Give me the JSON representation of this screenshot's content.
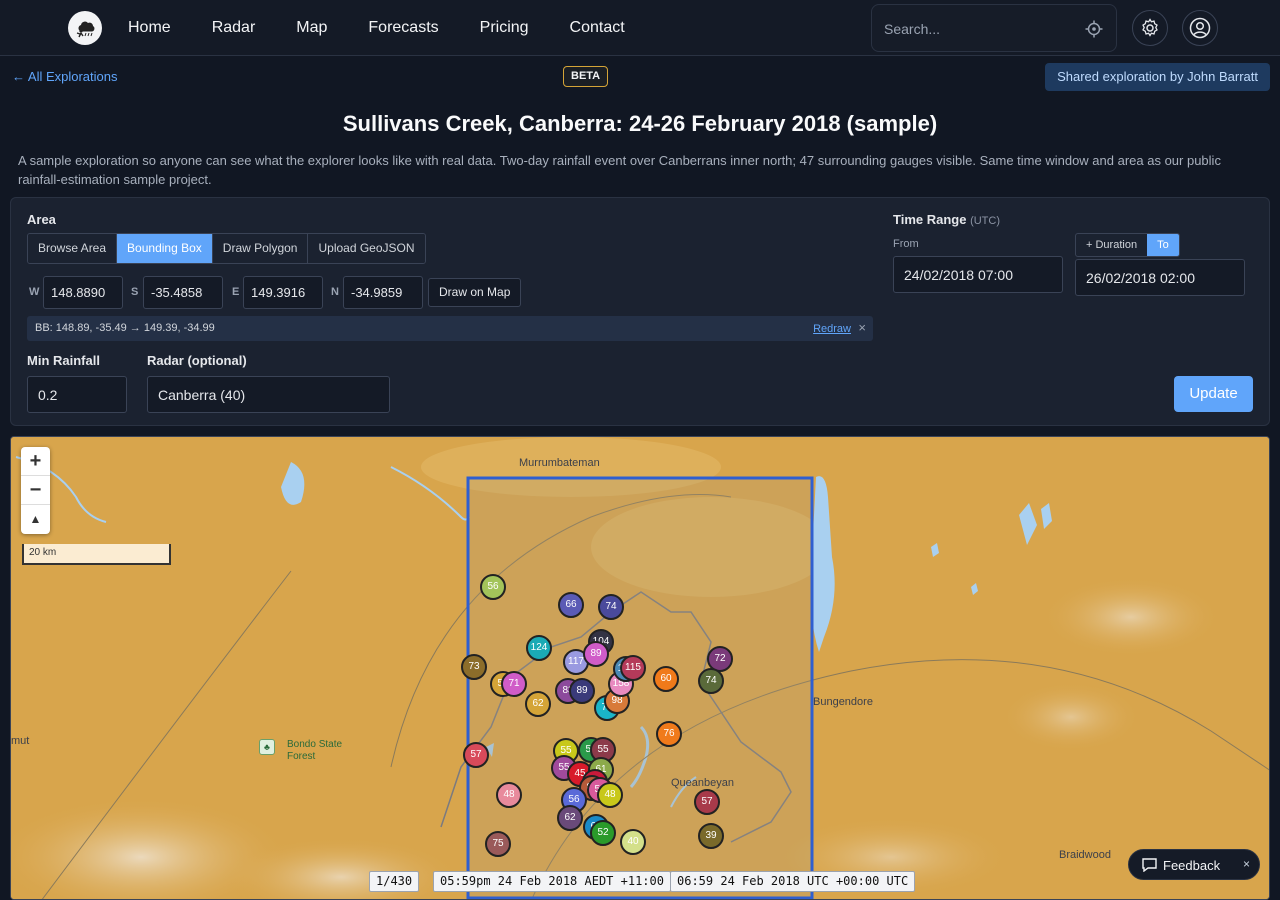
{
  "nav": {
    "links": [
      "Home",
      "Radar",
      "Map",
      "Forecasts",
      "Pricing",
      "Contact"
    ],
    "search_placeholder": "Search..."
  },
  "header": {
    "back_label": "← All Explorations",
    "beta_label": "BETA",
    "shared_label": "Shared exploration by John Barratt",
    "title": "Sullivans Creek, Canberra: 24-26 February 2018 (sample)",
    "description": "A sample exploration so anyone can see what the explorer looks like with real data. Two-day rainfall event over Canberrans inner north; 47 surrounding gauges visible. Same time window and area as our public rainfall-estimation sample project."
  },
  "area": {
    "label": "Area",
    "modes": [
      "Browse Area",
      "Bounding Box",
      "Draw Polygon",
      "Upload GeoJSON"
    ],
    "active_mode": "Bounding Box",
    "w_label": "W",
    "w_value": "148.8890",
    "s_label": "S",
    "s_value": "-35.4858",
    "e_label": "E",
    "e_value": "149.3916",
    "n_label": "N",
    "n_value": "-34.9859",
    "draw_button": "Draw on Map",
    "bb_summary": "BB: 148.89, -35.49 → 149.39, -34.99",
    "redraw_label": "Redraw",
    "clear_icon": "×"
  },
  "min_rainfall": {
    "label": "Min Rainfall",
    "value": "0.2"
  },
  "radar": {
    "label": "Radar (optional)",
    "value": "Canberra (40)"
  },
  "time_range": {
    "label": "Time Range",
    "unit": "(UTC)",
    "from_label": "From",
    "from_value": "24/02/2018 07:00",
    "duration_label": "+ Duration",
    "to_label": "To",
    "to_value": "26/02/2018 02:00"
  },
  "update_button": "Update",
  "map": {
    "places": [
      "Murrumbateman",
      "Bungendore",
      "Queanbeyan",
      "Bondo State Forest",
      "mut",
      "Braidwood"
    ],
    "scale_label": "20 km",
    "zoom_in": "+",
    "zoom_out": "−",
    "compass": "▲",
    "gauges": [
      {
        "v": "56",
        "c": "#a3c45a"
      },
      {
        "v": "66",
        "c": "#5b5bb5"
      },
      {
        "v": "74",
        "c": "#4a4a9c"
      },
      {
        "v": "104",
        "c": "#333344"
      },
      {
        "v": "124",
        "c": "#1aaab5"
      },
      {
        "v": "117",
        "c": "#9a9ae0"
      },
      {
        "v": "89",
        "c": "#d05cc8"
      },
      {
        "v": "73",
        "c": "#8c6d2a"
      },
      {
        "v": "58",
        "c": "#d4a437"
      },
      {
        "v": "71",
        "c": "#d05cc8"
      },
      {
        "v": "83",
        "c": "#8c4a9c"
      },
      {
        "v": "89",
        "c": "#3a3a7a"
      },
      {
        "v": "62",
        "c": "#d4a437"
      },
      {
        "v": "72",
        "c": "#1ab5c8"
      },
      {
        "v": "98",
        "c": "#d87a3a"
      },
      {
        "v": "158",
        "c": "#e88ac0"
      },
      {
        "v": "100",
        "c": "#4a8ab5"
      },
      {
        "v": "115",
        "c": "#b53a5a"
      },
      {
        "v": "60",
        "c": "#f07a1a"
      },
      {
        "v": "72",
        "c": "#7a3a7a"
      },
      {
        "v": "74",
        "c": "#5a6a3a"
      },
      {
        "v": "76",
        "c": "#f07a1a"
      },
      {
        "v": "57",
        "c": "#d84a5a"
      },
      {
        "v": "55",
        "c": "#c8c81a"
      },
      {
        "v": "54",
        "c": "#2a9a4a"
      },
      {
        "v": "55",
        "c": "#8c3a4a"
      },
      {
        "v": "55",
        "c": "#a04a9c"
      },
      {
        "v": "45",
        "c": "#d81a2a"
      },
      {
        "v": "61",
        "c": "#8caa4a"
      },
      {
        "v": "87",
        "c": "#c81a3a"
      },
      {
        "v": "84",
        "c": "#b55a3a"
      },
      {
        "v": "53",
        "c": "#d85a9c"
      },
      {
        "v": "48",
        "c": "#c8c81a"
      },
      {
        "v": "48",
        "c": "#e88a9c"
      },
      {
        "v": "56",
        "c": "#5a6ad8"
      },
      {
        "v": "62",
        "c": "#6a4a7a"
      },
      {
        "v": "64",
        "c": "#1a8ac8"
      },
      {
        "v": "52",
        "c": "#2a9a2a"
      },
      {
        "v": "40",
        "c": "#d4e08a"
      },
      {
        "v": "57",
        "c": "#a83a4a"
      },
      {
        "v": "39",
        "c": "#7a6a2a"
      },
      {
        "v": "75",
        "c": "#9a5a5a"
      }
    ],
    "frame_label": "1/430",
    "local_time": "05:59pm 24 Feb 2018 AEDT +11:00",
    "utc_time": "06:59 24 Feb 2018 UTC +00:00 UTC"
  },
  "feedback": {
    "label": "Feedback",
    "close": "×"
  }
}
